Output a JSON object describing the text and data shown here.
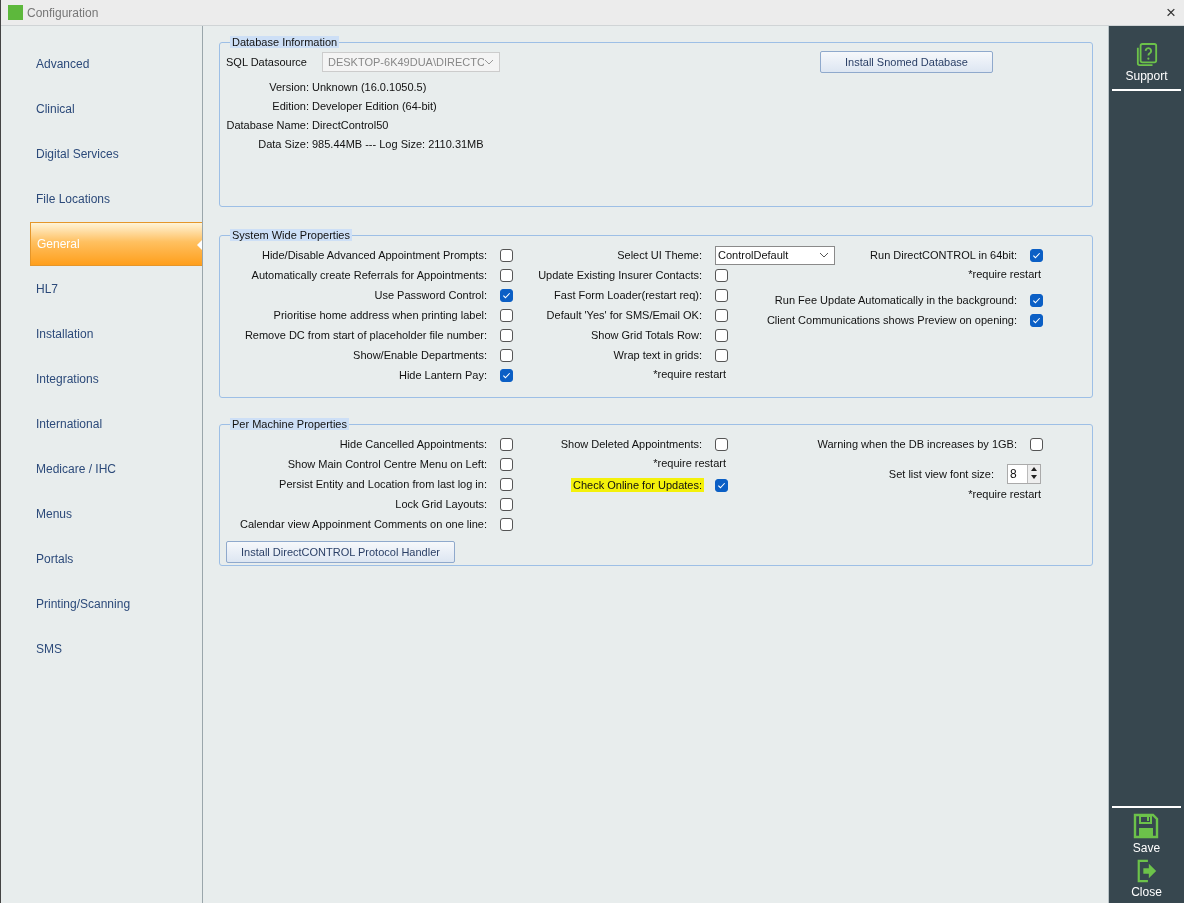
{
  "window": {
    "title": "Configuration",
    "close": "×"
  },
  "sidebar": {
    "items": [
      {
        "label": "Advanced",
        "selected": false
      },
      {
        "label": "Clinical",
        "selected": false
      },
      {
        "label": "Digital Services",
        "selected": false
      },
      {
        "label": "File Locations",
        "selected": false
      },
      {
        "label": "General",
        "selected": true
      },
      {
        "label": "HL7",
        "selected": false
      },
      {
        "label": "Installation",
        "selected": false
      },
      {
        "label": "Integrations",
        "selected": false
      },
      {
        "label": "International",
        "selected": false
      },
      {
        "label": "Medicare / IHC",
        "selected": false
      },
      {
        "label": "Menus",
        "selected": false
      },
      {
        "label": "Portals",
        "selected": false
      },
      {
        "label": "Printing/Scanning",
        "selected": false
      },
      {
        "label": "SMS",
        "selected": false
      }
    ]
  },
  "database_information": {
    "title": "Database Information",
    "datasource": {
      "label": "SQL Datasource",
      "value": "DESKTOP-6K49DUA\\DIRECTC",
      "disabled": true
    },
    "install_button": "Install Snomed Database",
    "fields": [
      {
        "label": "Version:",
        "value": "Unknown (16.0.1050.5)"
      },
      {
        "label": "Edition:",
        "value": "Developer Edition (64-bit)"
      },
      {
        "label": "Database Name:",
        "value": "DirectControl50"
      },
      {
        "label": "Data Size:",
        "value": "985.44MB --- Log Size: 2110.31MB"
      }
    ]
  },
  "system_wide_properties": {
    "title": "System Wide Properties",
    "columns": [
      [
        {
          "kind": "checkbox",
          "label": "Hide/Disable Advanced Appointment Prompts:",
          "checked": false
        },
        {
          "kind": "checkbox",
          "label": "Automatically create Referrals for Appointments:",
          "checked": false
        },
        {
          "kind": "checkbox",
          "label": "Use Password Control:",
          "checked": true
        },
        {
          "kind": "checkbox",
          "label": "Prioritise home address when printing label:",
          "checked": false
        },
        {
          "kind": "checkbox",
          "label": "Remove DC from start of placeholder file number:",
          "checked": false
        },
        {
          "kind": "checkbox",
          "label": "Show/Enable Departments:",
          "checked": false
        },
        {
          "kind": "checkbox",
          "label": "Hide Lantern Pay:",
          "checked": true
        }
      ],
      [
        {
          "kind": "select",
          "label": "Select UI Theme:",
          "value": "ControlDefault"
        },
        {
          "kind": "checkbox",
          "label": "Update Existing Insurer Contacts:",
          "checked": false
        },
        {
          "kind": "checkbox",
          "label": "Fast Form Loader(restart req):",
          "checked": false
        },
        {
          "kind": "checkbox",
          "label": "Default 'Yes' for SMS/Email OK:",
          "checked": false
        },
        {
          "kind": "checkbox",
          "label": "Show Grid Totals Row:",
          "checked": false
        },
        {
          "kind": "checkbox",
          "label": "Wrap text in grids:",
          "checked": false
        },
        {
          "kind": "note",
          "label": "*require restart"
        }
      ],
      [
        {
          "kind": "checkbox",
          "label": "Run DirectCONTROL in 64bit:",
          "checked": true
        },
        {
          "kind": "note",
          "label": "*require restart"
        },
        {
          "kind": "checkbox",
          "label": "Run Fee Update Automatically in the background:",
          "checked": true
        },
        {
          "kind": "checkbox",
          "label": "Client Communications shows Preview on opening:",
          "checked": true
        }
      ]
    ]
  },
  "per_machine_properties": {
    "title": "Per Machine Properties",
    "columns": [
      [
        {
          "kind": "checkbox",
          "label": "Hide Cancelled Appointments:",
          "checked": false,
          "highlighted": false
        },
        {
          "kind": "checkbox",
          "label": "Show Main Control Centre Menu on Left:",
          "checked": false,
          "highlighted": false
        },
        {
          "kind": "checkbox",
          "label": "Persist Entity and Location from last log in:",
          "checked": false,
          "highlighted": false
        },
        {
          "kind": "checkbox",
          "label": "Lock Grid Layouts:",
          "checked": false,
          "highlighted": false
        },
        {
          "kind": "checkbox",
          "label": "Calendar view Appoinment Comments on one line:",
          "checked": false,
          "highlighted": false
        }
      ],
      [
        {
          "kind": "checkbox",
          "label": "Show Deleted Appointments:",
          "checked": false,
          "highlighted": false
        },
        {
          "kind": "note",
          "label": "*require restart"
        },
        {
          "kind": "checkbox",
          "label": "Check Online for Updates:",
          "checked": true,
          "highlighted": true
        }
      ],
      [
        {
          "kind": "checkbox",
          "label": "Warning when the DB increases by 1GB:",
          "checked": false,
          "highlighted": false
        },
        {
          "kind": "spinner",
          "label": "Set list view font size:",
          "value": "8"
        },
        {
          "kind": "note",
          "label": "*require restart"
        }
      ]
    ],
    "install_button": "Install DirectCONTROL Protocol Handler"
  },
  "action_bar": {
    "top": [
      {
        "kind": "support",
        "label": "Support"
      }
    ],
    "bottom": [
      {
        "kind": "save",
        "label": "Save"
      },
      {
        "kind": "close",
        "label": "Close"
      }
    ]
  }
}
